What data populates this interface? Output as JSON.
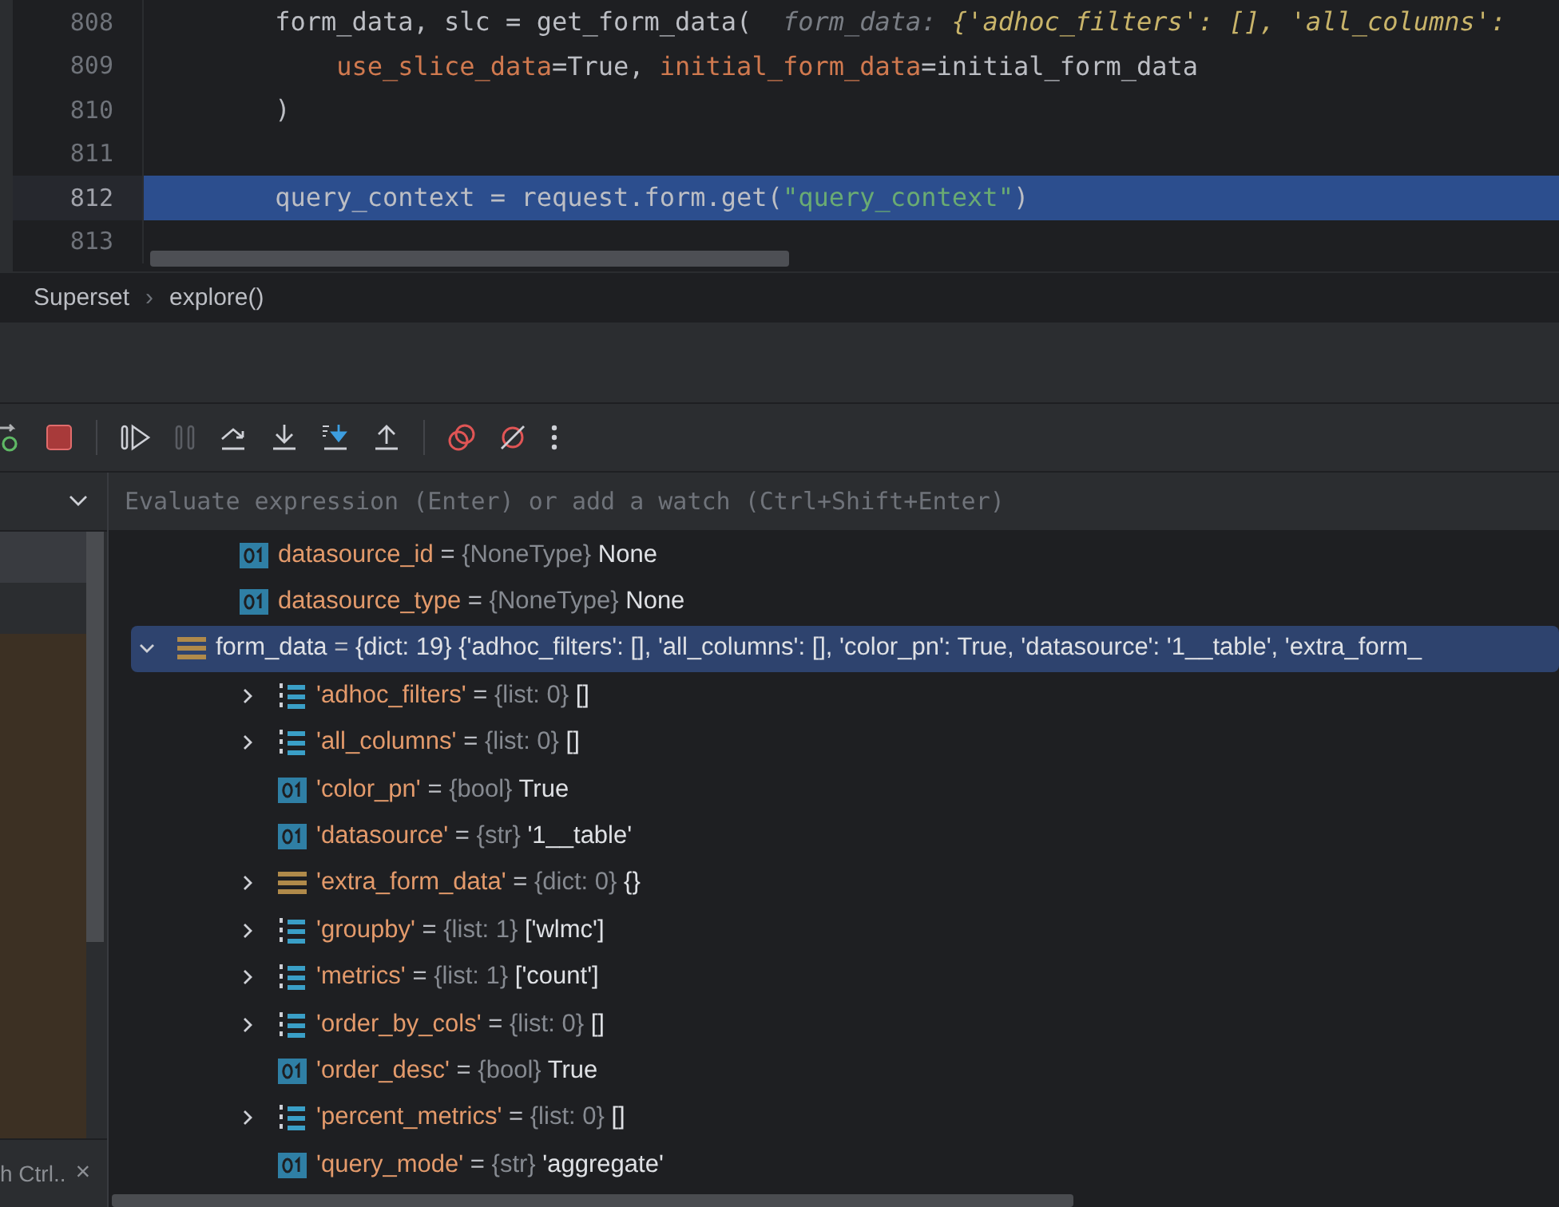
{
  "editor": {
    "lines": [
      {
        "number": "808",
        "current": false,
        "tokens": [
          {
            "kind": "plain",
            "text": "        form_data, slc = get_form_data(  "
          },
          {
            "kind": "hint-label",
            "text": "form_data: "
          },
          {
            "kind": "hint-value",
            "text": "{'adhoc_filters': [], 'all_columns':"
          }
        ]
      },
      {
        "number": "809",
        "current": false,
        "tokens": [
          {
            "kind": "arg",
            "text": "            use_slice_data"
          },
          {
            "kind": "plain",
            "text": "=True, "
          },
          {
            "kind": "arg",
            "text": "initial_form_data"
          },
          {
            "kind": "plain",
            "text": "=initial_form_data"
          }
        ]
      },
      {
        "number": "810",
        "current": false,
        "tokens": [
          {
            "kind": "plain",
            "text": "        )"
          }
        ]
      },
      {
        "number": "811",
        "current": false
      },
      {
        "number": "812",
        "current": true,
        "tokens": [
          {
            "kind": "plain",
            "text": "        query_context = request.form.get("
          },
          {
            "kind": "string",
            "text": "\"query_context\""
          },
          {
            "kind": "plain",
            "text": ")"
          }
        ]
      },
      {
        "number": "813",
        "current": false
      }
    ]
  },
  "breadcrumb": {
    "items": [
      "Superset",
      "explore()"
    ],
    "separator": "›"
  },
  "toolbar": [
    {
      "kind": "rerun",
      "disabled": false
    },
    {
      "kind": "stop",
      "disabled": false
    },
    {
      "kind": "resume",
      "disabled": false
    },
    {
      "kind": "pause",
      "disabled": true
    },
    {
      "kind": "step-over",
      "disabled": false
    },
    {
      "kind": "step-into",
      "disabled": false
    },
    {
      "kind": "step-into-my-code",
      "disabled": false
    },
    {
      "kind": "step-out",
      "disabled": false
    },
    {
      "kind": "breakpoints",
      "disabled": false
    },
    {
      "kind": "mute-breakpoints",
      "disabled": false
    },
    {
      "kind": "more",
      "disabled": false
    }
  ],
  "evaluate": {
    "placeholder": "Evaluate expression (Enter) or add a watch (Ctrl+Shift+Enter)"
  },
  "frames_footer": {
    "text": "h Ctrl..",
    "close": "×"
  },
  "variables": [
    {
      "name": "datasource_id",
      "eq": "=",
      "type": "{NoneType}",
      "value": "None",
      "kind": "scalar",
      "selected": false
    },
    {
      "name": "datasource_type",
      "eq": "=",
      "type": "{NoneType}",
      "value": "None",
      "kind": "scalar",
      "selected": false
    },
    {
      "name": "form_data",
      "eq": "=",
      "type": "{dict: 19}",
      "value": "{'adhoc_filters': [], 'all_columns': [], 'color_pn': True, 'datasource': '1__table', 'extra_form_",
      "kind": "dict",
      "expanded": true,
      "selected": true,
      "children": [
        {
          "name": "'adhoc_filters'",
          "eq": "=",
          "type": "{list: 0}",
          "value": "[]",
          "kind": "list",
          "expanded": false,
          "selected": false
        },
        {
          "name": "'all_columns'",
          "eq": "=",
          "type": "{list: 0}",
          "value": "[]",
          "kind": "list",
          "expanded": false,
          "selected": false
        },
        {
          "name": "'color_pn'",
          "eq": "=",
          "type": "{bool}",
          "value": "True",
          "kind": "scalar",
          "selected": false
        },
        {
          "name": "'datasource'",
          "eq": "=",
          "type": "{str}",
          "value": "'1__table'",
          "kind": "scalar",
          "selected": false
        },
        {
          "name": "'extra_form_data'",
          "eq": "=",
          "type": "{dict: 0}",
          "value": "{}",
          "kind": "dict",
          "expanded": false,
          "selected": false
        },
        {
          "name": "'groupby'",
          "eq": "=",
          "type": "{list: 1}",
          "value": "['wlmc']",
          "kind": "list",
          "expanded": false,
          "selected": false
        },
        {
          "name": "'metrics'",
          "eq": "=",
          "type": "{list: 1}",
          "value": "['count']",
          "kind": "list",
          "expanded": false,
          "selected": false
        },
        {
          "name": "'order_by_cols'",
          "eq": "=",
          "type": "{list: 0}",
          "value": "[]",
          "kind": "list",
          "expanded": false,
          "selected": false
        },
        {
          "name": "'order_desc'",
          "eq": "=",
          "type": "{bool}",
          "value": "True",
          "kind": "scalar",
          "selected": false
        },
        {
          "name": "'percent_metrics'",
          "eq": "=",
          "type": "{list: 0}",
          "value": "[]",
          "kind": "list",
          "expanded": false,
          "selected": false
        },
        {
          "name": "'query_mode'",
          "eq": "=",
          "type": "{str}",
          "value": "'aggregate'",
          "kind": "scalar",
          "selected": false
        }
      ]
    }
  ]
}
